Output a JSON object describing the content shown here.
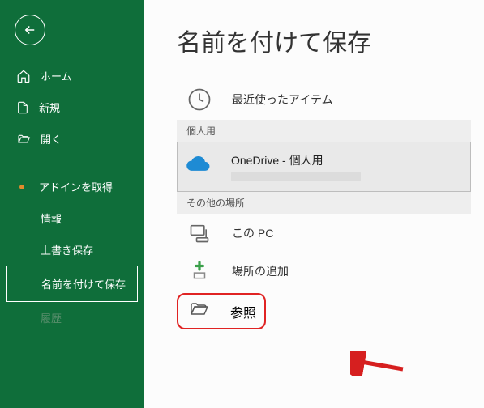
{
  "sidebar": {
    "home": "ホーム",
    "new": "新規",
    "open": "開く",
    "get_addins": "アドインを取得",
    "info": "情報",
    "save_over": "上書き保存",
    "save_as": "名前を付けて保存",
    "history_faded": "履歴"
  },
  "main": {
    "title": "名前を付けて保存",
    "recent": "最近使ったアイテム",
    "section_personal": "個人用",
    "onedrive_title": "OneDrive - 個人用",
    "section_other": "その他の場所",
    "this_pc": "この PC",
    "add_location": "場所の追加",
    "browse": "参照"
  }
}
